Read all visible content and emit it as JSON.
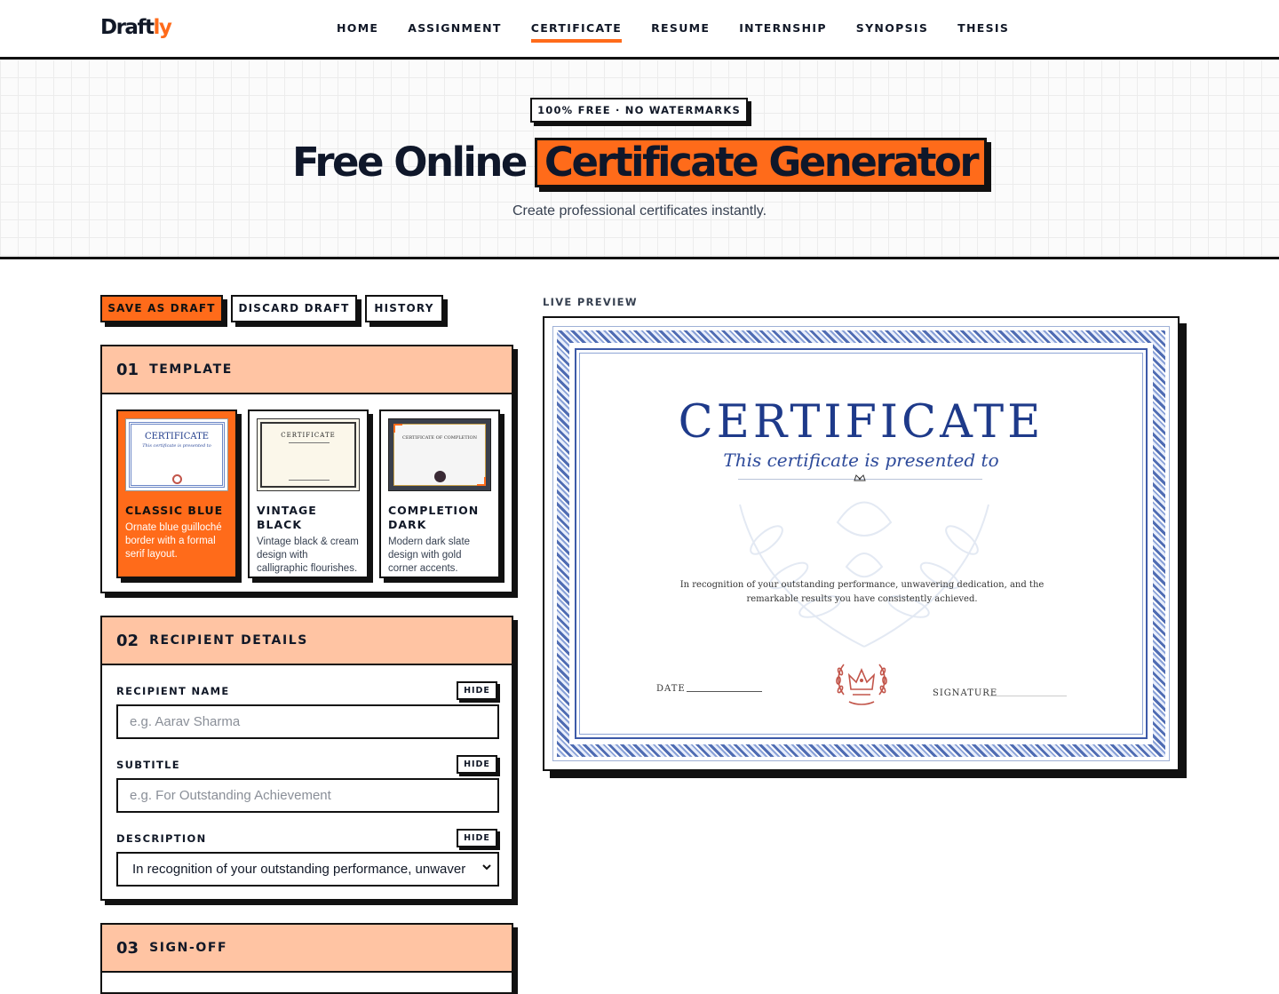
{
  "nav": {
    "logo_main": "Draft",
    "logo_accent": "ly",
    "items": [
      {
        "label": "HOME"
      },
      {
        "label": "ASSIGNMENT"
      },
      {
        "label": "CERTIFICATE",
        "active": true
      },
      {
        "label": "RESUME"
      },
      {
        "label": "INTERNSHIP"
      },
      {
        "label": "SYNOPSIS"
      },
      {
        "label": "THESIS"
      }
    ]
  },
  "hero": {
    "badge": "100% FREE · NO WATERMARKS",
    "title_plain": "Free Online",
    "title_highlight": "Certificate Generator",
    "subtitle": "Create professional certificates instantly."
  },
  "actions": {
    "save": "SAVE AS DRAFT",
    "discard": "DISCARD DRAFT",
    "history": "HISTORY"
  },
  "template_section": {
    "num": "01",
    "label": "TEMPLATE",
    "templates": [
      {
        "name": "CLASSIC BLUE",
        "desc": "Ornate blue guilloché border with a formal serif layout.",
        "selected": true,
        "thumb_title": "CERTIFICATE",
        "thumb_sub": "This certificate is presented to"
      },
      {
        "name": "VINTAGE BLACK",
        "desc": "Vintage black & cream design with calligraphic flourishes.",
        "selected": false,
        "thumb_title": "CERTIFICATE"
      },
      {
        "name": "COMPLETION DARK",
        "desc": "Modern dark slate design with gold corner accents.",
        "selected": false,
        "thumb_title": "CERTIFICATE OF COMPLETION"
      }
    ]
  },
  "recipient_section": {
    "num": "02",
    "label": "RECIPIENT DETAILS",
    "hide_label": "HIDE",
    "fields": {
      "name_label": "RECIPIENT NAME",
      "name_placeholder": "e.g. Aarav Sharma",
      "subtitle_label": "SUBTITLE",
      "subtitle_placeholder": "e.g. For Outstanding Achievement",
      "description_label": "DESCRIPTION",
      "description_value": "In recognition of your outstanding performance, unwaver"
    }
  },
  "signoff_section": {
    "num": "03",
    "label": "SIGN-OFF"
  },
  "preview": {
    "label": "LIVE PREVIEW",
    "cert_title": "CERTIFICATE",
    "cert_subtitle": "This certificate is presented to",
    "cert_description": "In recognition of your outstanding performance, unwavering dedication, and the remarkable results you have consistently achieved.",
    "date_label": "DATE",
    "signature_label": "SIGNATURE"
  },
  "colors": {
    "accent": "#ff6b1a",
    "panel_header": "#ffc4a3",
    "ink": "#111111",
    "cert_blue": "#1e3a8a"
  }
}
